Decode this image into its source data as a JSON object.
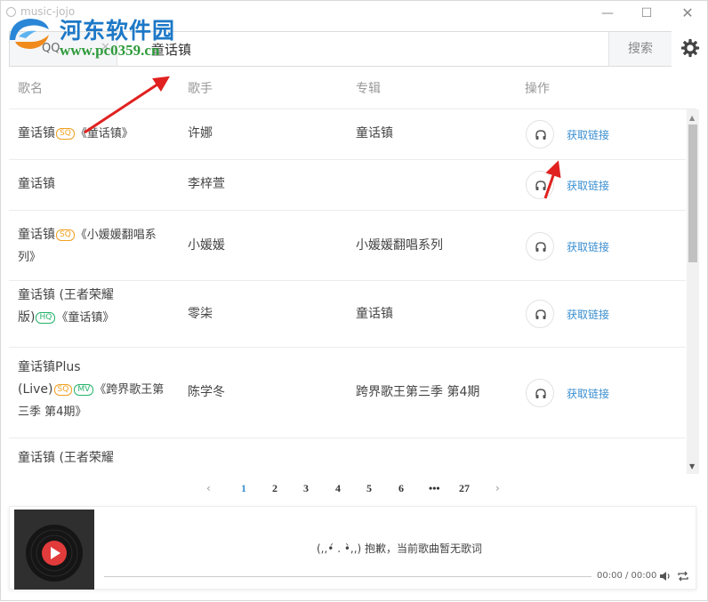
{
  "window": {
    "title": "music-jojo"
  },
  "watermark": {
    "name": "河东软件园",
    "url": "www.pc0359.cn"
  },
  "search": {
    "source": "QQ",
    "query": "童话镇",
    "button_label": "搜索"
  },
  "table": {
    "headers": [
      "歌名",
      "歌手",
      "专辑",
      "操作"
    ],
    "link_label": "获取链接",
    "rows": [
      {
        "name_lines": [
          "童话镇"
        ],
        "tags": [
          "SQ"
        ],
        "name_album": "《童话镇》",
        "singer": "许娜",
        "album": "童话镇"
      },
      {
        "name_lines": [
          "童话镇"
        ],
        "tags": [],
        "name_album": "",
        "singer": "李梓萱",
        "album": ""
      },
      {
        "name_lines": [
          "童话镇"
        ],
        "tags": [
          "SQ"
        ],
        "name_album": "《小媛媛翻唱系列》",
        "singer": "小媛媛",
        "album": "小媛媛翻唱系列"
      },
      {
        "name_lines": [
          "童话镇 (王者荣耀",
          "版)"
        ],
        "tags": [
          "HQ"
        ],
        "name_album": "《童话镇》",
        "singer": "零柒",
        "album": "童话镇"
      },
      {
        "name_lines": [
          "童话镇Plus",
          "(Live)"
        ],
        "tags": [
          "SQ",
          "MV"
        ],
        "name_album": "《跨界歌王第三季 第4期》",
        "singer": "陈学冬",
        "album": "跨界歌王第三季 第4期"
      },
      {
        "name_lines": [
          "童话镇 (王者荣耀"
        ],
        "tags": [],
        "name_album": "",
        "singer": "",
        "album": ""
      }
    ]
  },
  "pagination": {
    "pages": [
      "1",
      "2",
      "3",
      "4",
      "5",
      "6",
      "•••",
      "27"
    ],
    "current": "1",
    "prev": "‹",
    "next": "›"
  },
  "player": {
    "lyric": "(,,•́ . •̀,,) 抱歉，当前歌曲暂无歌词",
    "time": "00:00 / 00:00"
  },
  "colors": {
    "accent": "#3b8fd0",
    "sq": "#f0a020",
    "hq": "#27b36b",
    "arrow": "#e0211f"
  }
}
